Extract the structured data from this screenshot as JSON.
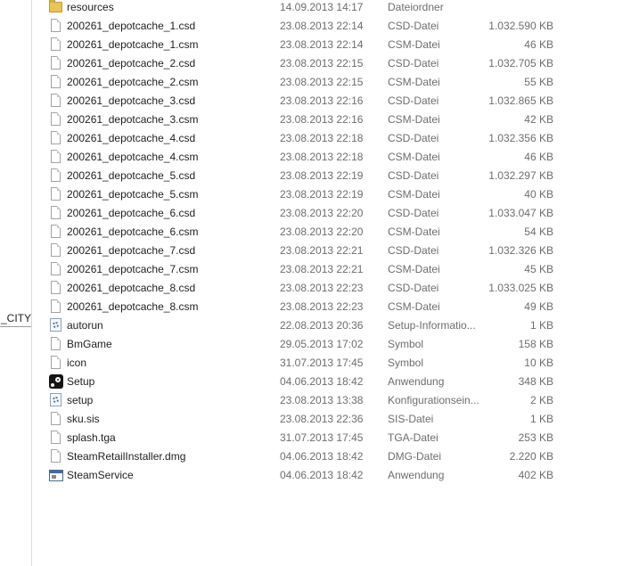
{
  "nav": {
    "partial_item": "_CITY_"
  },
  "files": [
    {
      "name": "resources",
      "date": "14.09.2013 14:17",
      "type": "Dateiordner",
      "size": "",
      "icon": "folder-icon"
    },
    {
      "name": "200261_depotcache_1.csd",
      "date": "23.08.2013 22:14",
      "type": "CSD-Datei",
      "size": "1.032.590 KB",
      "icon": "file-icon"
    },
    {
      "name": "200261_depotcache_1.csm",
      "date": "23.08.2013 22:14",
      "type": "CSM-Datei",
      "size": "46 KB",
      "icon": "file-icon"
    },
    {
      "name": "200261_depotcache_2.csd",
      "date": "23.08.2013 22:15",
      "type": "CSD-Datei",
      "size": "1.032.705 KB",
      "icon": "file-icon"
    },
    {
      "name": "200261_depotcache_2.csm",
      "date": "23.08.2013 22:15",
      "type": "CSM-Datei",
      "size": "55 KB",
      "icon": "file-icon"
    },
    {
      "name": "200261_depotcache_3.csd",
      "date": "23.08.2013 22:16",
      "type": "CSD-Datei",
      "size": "1.032.865 KB",
      "icon": "file-icon"
    },
    {
      "name": "200261_depotcache_3.csm",
      "date": "23.08.2013 22:16",
      "type": "CSM-Datei",
      "size": "42 KB",
      "icon": "file-icon"
    },
    {
      "name": "200261_depotcache_4.csd",
      "date": "23.08.2013 22:18",
      "type": "CSD-Datei",
      "size": "1.032.356 KB",
      "icon": "file-icon"
    },
    {
      "name": "200261_depotcache_4.csm",
      "date": "23.08.2013 22:18",
      "type": "CSM-Datei",
      "size": "46 KB",
      "icon": "file-icon"
    },
    {
      "name": "200261_depotcache_5.csd",
      "date": "23.08.2013 22:19",
      "type": "CSD-Datei",
      "size": "1.032.297 KB",
      "icon": "file-icon"
    },
    {
      "name": "200261_depotcache_5.csm",
      "date": "23.08.2013 22:19",
      "type": "CSM-Datei",
      "size": "40 KB",
      "icon": "file-icon"
    },
    {
      "name": "200261_depotcache_6.csd",
      "date": "23.08.2013 22:20",
      "type": "CSD-Datei",
      "size": "1.033.047 KB",
      "icon": "file-icon"
    },
    {
      "name": "200261_depotcache_6.csm",
      "date": "23.08.2013 22:20",
      "type": "CSM-Datei",
      "size": "54 KB",
      "icon": "file-icon"
    },
    {
      "name": "200261_depotcache_7.csd",
      "date": "23.08.2013 22:21",
      "type": "CSD-Datei",
      "size": "1.032.326 KB",
      "icon": "file-icon"
    },
    {
      "name": "200261_depotcache_7.csm",
      "date": "23.08.2013 22:21",
      "type": "CSM-Datei",
      "size": "45 KB",
      "icon": "file-icon"
    },
    {
      "name": "200261_depotcache_8.csd",
      "date": "23.08.2013 22:23",
      "type": "CSD-Datei",
      "size": "1.033.025 KB",
      "icon": "file-icon"
    },
    {
      "name": "200261_depotcache_8.csm",
      "date": "23.08.2013 22:23",
      "type": "CSM-Datei",
      "size": "49 KB",
      "icon": "file-icon"
    },
    {
      "name": "autorun",
      "date": "22.08.2013 20:36",
      "type": "Setup-Informatio...",
      "size": "1 KB",
      "icon": "settings-file-icon"
    },
    {
      "name": "BmGame",
      "date": "29.05.2013 17:02",
      "type": "Symbol",
      "size": "158 KB",
      "icon": "file-icon"
    },
    {
      "name": "icon",
      "date": "31.07.2013 17:45",
      "type": "Symbol",
      "size": "10 KB",
      "icon": "file-icon"
    },
    {
      "name": "Setup",
      "date": "04.06.2013 18:42",
      "type": "Anwendung",
      "size": "348 KB",
      "icon": "steam-icon"
    },
    {
      "name": "setup",
      "date": "23.08.2013 13:38",
      "type": "Konfigurationsein...",
      "size": "2 KB",
      "icon": "settings-file-icon"
    },
    {
      "name": "sku.sis",
      "date": "23.08.2013 22:36",
      "type": "SIS-Datei",
      "size": "1 KB",
      "icon": "file-icon"
    },
    {
      "name": "splash.tga",
      "date": "31.07.2013 17:45",
      "type": "TGA-Datei",
      "size": "253 KB",
      "icon": "file-icon"
    },
    {
      "name": "SteamRetailInstaller.dmg",
      "date": "04.06.2013 18:42",
      "type": "DMG-Datei",
      "size": "2.220 KB",
      "icon": "file-icon"
    },
    {
      "name": "SteamService",
      "date": "04.06.2013 18:42",
      "type": "Anwendung",
      "size": "402 KB",
      "icon": "application-icon"
    }
  ]
}
